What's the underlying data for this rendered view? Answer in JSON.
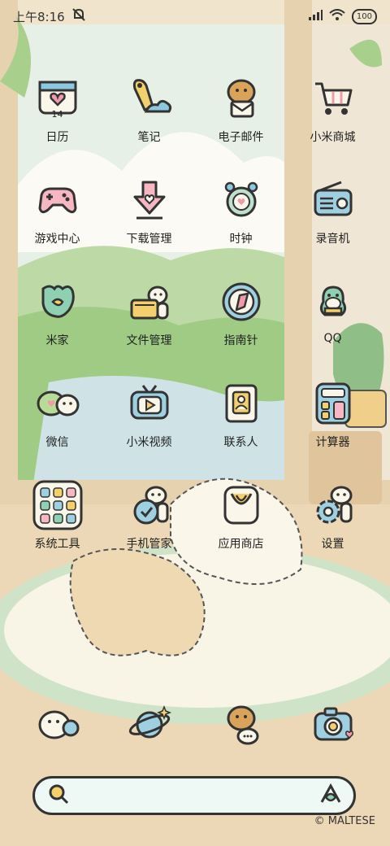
{
  "status_bar": {
    "time": "上午8:16",
    "battery_level": "100",
    "icons": [
      "notifications-muted-icon",
      "signal-icon",
      "wifi-icon",
      "battery-icon"
    ]
  },
  "apps": [
    {
      "label": "日历",
      "icon": "calendar-icon",
      "badge": "14"
    },
    {
      "label": "笔记",
      "icon": "notes-icon"
    },
    {
      "label": "电子邮件",
      "icon": "email-icon"
    },
    {
      "label": "小米商城",
      "icon": "shopping-cart-icon"
    },
    {
      "label": "游戏中心",
      "icon": "game-controller-icon"
    },
    {
      "label": "下载管理",
      "icon": "download-icon"
    },
    {
      "label": "时钟",
      "icon": "alarm-clock-icon"
    },
    {
      "label": "录音机",
      "icon": "radio-recorder-icon"
    },
    {
      "label": "米家",
      "icon": "mijia-icon"
    },
    {
      "label": "文件管理",
      "icon": "file-manager-icon"
    },
    {
      "label": "指南针",
      "icon": "compass-icon"
    },
    {
      "label": "QQ",
      "icon": "qq-penguin-icon"
    },
    {
      "label": "微信",
      "icon": "wechat-icon"
    },
    {
      "label": "小米视频",
      "icon": "tv-video-icon"
    },
    {
      "label": "联系人",
      "icon": "contacts-icon"
    },
    {
      "label": "计算器",
      "icon": "calculator-icon"
    },
    {
      "label": "系统工具",
      "icon": "folder-system-tools-icon"
    },
    {
      "label": "手机管家",
      "icon": "security-shield-icon"
    },
    {
      "label": "应用商店",
      "icon": "app-store-icon"
    },
    {
      "label": "设置",
      "icon": "gear-icon"
    }
  ],
  "dock": [
    {
      "icon": "dog-phone-icon"
    },
    {
      "icon": "planet-browser-icon"
    },
    {
      "icon": "dog-message-icon"
    },
    {
      "icon": "camera-icon"
    }
  ],
  "search_bar": {
    "left_icon": "search-icon",
    "right_icon": "xiaoai-assistant-icon"
  },
  "watermark": "© MALTESE",
  "colors": {
    "ink": "#333333",
    "pink": "#f19aa8",
    "blue": "#8cc9e0",
    "green": "#9fce8a",
    "yellow": "#f3d06b",
    "cream": "#fbf6ea",
    "peach": "#e9c89a"
  }
}
